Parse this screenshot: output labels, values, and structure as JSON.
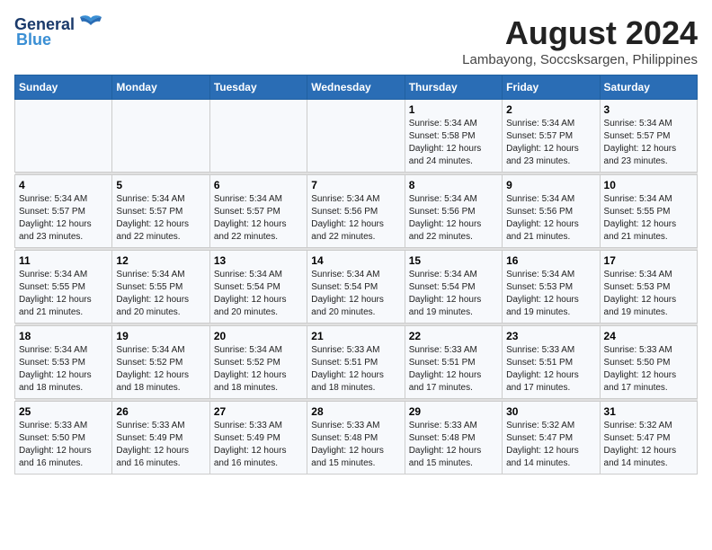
{
  "header": {
    "logo_line1": "General",
    "logo_line2": "Blue",
    "main_title": "August 2024",
    "subtitle": "Lambayong, Soccsksargen, Philippines"
  },
  "days_of_week": [
    "Sunday",
    "Monday",
    "Tuesday",
    "Wednesday",
    "Thursday",
    "Friday",
    "Saturday"
  ],
  "weeks": [
    [
      {
        "day": "",
        "info": ""
      },
      {
        "day": "",
        "info": ""
      },
      {
        "day": "",
        "info": ""
      },
      {
        "day": "",
        "info": ""
      },
      {
        "day": "1",
        "info": "Sunrise: 5:34 AM\nSunset: 5:58 PM\nDaylight: 12 hours\nand 24 minutes."
      },
      {
        "day": "2",
        "info": "Sunrise: 5:34 AM\nSunset: 5:57 PM\nDaylight: 12 hours\nand 23 minutes."
      },
      {
        "day": "3",
        "info": "Sunrise: 5:34 AM\nSunset: 5:57 PM\nDaylight: 12 hours\nand 23 minutes."
      }
    ],
    [
      {
        "day": "4",
        "info": "Sunrise: 5:34 AM\nSunset: 5:57 PM\nDaylight: 12 hours\nand 23 minutes."
      },
      {
        "day": "5",
        "info": "Sunrise: 5:34 AM\nSunset: 5:57 PM\nDaylight: 12 hours\nand 22 minutes."
      },
      {
        "day": "6",
        "info": "Sunrise: 5:34 AM\nSunset: 5:57 PM\nDaylight: 12 hours\nand 22 minutes."
      },
      {
        "day": "7",
        "info": "Sunrise: 5:34 AM\nSunset: 5:56 PM\nDaylight: 12 hours\nand 22 minutes."
      },
      {
        "day": "8",
        "info": "Sunrise: 5:34 AM\nSunset: 5:56 PM\nDaylight: 12 hours\nand 22 minutes."
      },
      {
        "day": "9",
        "info": "Sunrise: 5:34 AM\nSunset: 5:56 PM\nDaylight: 12 hours\nand 21 minutes."
      },
      {
        "day": "10",
        "info": "Sunrise: 5:34 AM\nSunset: 5:55 PM\nDaylight: 12 hours\nand 21 minutes."
      }
    ],
    [
      {
        "day": "11",
        "info": "Sunrise: 5:34 AM\nSunset: 5:55 PM\nDaylight: 12 hours\nand 21 minutes."
      },
      {
        "day": "12",
        "info": "Sunrise: 5:34 AM\nSunset: 5:55 PM\nDaylight: 12 hours\nand 20 minutes."
      },
      {
        "day": "13",
        "info": "Sunrise: 5:34 AM\nSunset: 5:54 PM\nDaylight: 12 hours\nand 20 minutes."
      },
      {
        "day": "14",
        "info": "Sunrise: 5:34 AM\nSunset: 5:54 PM\nDaylight: 12 hours\nand 20 minutes."
      },
      {
        "day": "15",
        "info": "Sunrise: 5:34 AM\nSunset: 5:54 PM\nDaylight: 12 hours\nand 19 minutes."
      },
      {
        "day": "16",
        "info": "Sunrise: 5:34 AM\nSunset: 5:53 PM\nDaylight: 12 hours\nand 19 minutes."
      },
      {
        "day": "17",
        "info": "Sunrise: 5:34 AM\nSunset: 5:53 PM\nDaylight: 12 hours\nand 19 minutes."
      }
    ],
    [
      {
        "day": "18",
        "info": "Sunrise: 5:34 AM\nSunset: 5:53 PM\nDaylight: 12 hours\nand 18 minutes."
      },
      {
        "day": "19",
        "info": "Sunrise: 5:34 AM\nSunset: 5:52 PM\nDaylight: 12 hours\nand 18 minutes."
      },
      {
        "day": "20",
        "info": "Sunrise: 5:34 AM\nSunset: 5:52 PM\nDaylight: 12 hours\nand 18 minutes."
      },
      {
        "day": "21",
        "info": "Sunrise: 5:33 AM\nSunset: 5:51 PM\nDaylight: 12 hours\nand 18 minutes."
      },
      {
        "day": "22",
        "info": "Sunrise: 5:33 AM\nSunset: 5:51 PM\nDaylight: 12 hours\nand 17 minutes."
      },
      {
        "day": "23",
        "info": "Sunrise: 5:33 AM\nSunset: 5:51 PM\nDaylight: 12 hours\nand 17 minutes."
      },
      {
        "day": "24",
        "info": "Sunrise: 5:33 AM\nSunset: 5:50 PM\nDaylight: 12 hours\nand 17 minutes."
      }
    ],
    [
      {
        "day": "25",
        "info": "Sunrise: 5:33 AM\nSunset: 5:50 PM\nDaylight: 12 hours\nand 16 minutes."
      },
      {
        "day": "26",
        "info": "Sunrise: 5:33 AM\nSunset: 5:49 PM\nDaylight: 12 hours\nand 16 minutes."
      },
      {
        "day": "27",
        "info": "Sunrise: 5:33 AM\nSunset: 5:49 PM\nDaylight: 12 hours\nand 16 minutes."
      },
      {
        "day": "28",
        "info": "Sunrise: 5:33 AM\nSunset: 5:48 PM\nDaylight: 12 hours\nand 15 minutes."
      },
      {
        "day": "29",
        "info": "Sunrise: 5:33 AM\nSunset: 5:48 PM\nDaylight: 12 hours\nand 15 minutes."
      },
      {
        "day": "30",
        "info": "Sunrise: 5:32 AM\nSunset: 5:47 PM\nDaylight: 12 hours\nand 14 minutes."
      },
      {
        "day": "31",
        "info": "Sunrise: 5:32 AM\nSunset: 5:47 PM\nDaylight: 12 hours\nand 14 minutes."
      }
    ]
  ]
}
